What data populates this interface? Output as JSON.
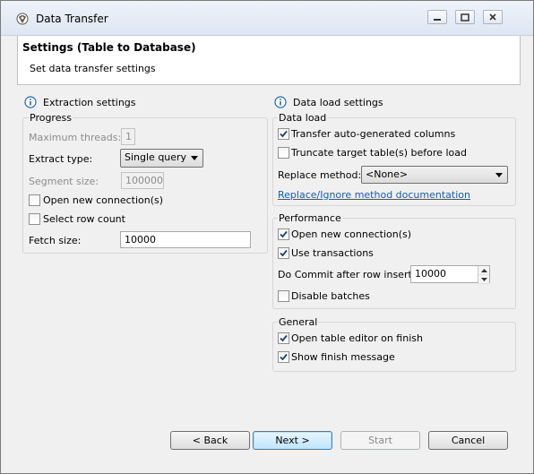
{
  "window": {
    "title": "Data Transfer"
  },
  "header": {
    "title": "Settings (Table to Database)",
    "subtitle": "Set data transfer settings"
  },
  "extraction": {
    "heading": "Extraction settings",
    "progress_group": "Progress",
    "max_threads_label": "Maximum threads:",
    "max_threads_value": "1",
    "extract_type_label": "Extract type:",
    "extract_type_value": "Single query",
    "segment_size_label": "Segment size:",
    "segment_size_value": "100000",
    "open_new_connections": {
      "label": "Open new connection(s)",
      "checked": false
    },
    "select_row_count": {
      "label": "Select row count",
      "checked": false
    },
    "fetch_size_label": "Fetch size:",
    "fetch_size_value": "10000"
  },
  "dataload": {
    "heading": "Data load settings",
    "group": "Data load",
    "transfer_auto_generated": {
      "label": "Transfer auto-generated columns",
      "checked": true
    },
    "truncate_target": {
      "label": "Truncate target table(s) before load",
      "checked": false
    },
    "replace_method_label": "Replace method:",
    "replace_method_value": "<None>",
    "replace_doc_link": "Replace/Ignore method documentation"
  },
  "performance": {
    "group": "Performance",
    "open_new_connections": {
      "label": "Open new connection(s)",
      "checked": true
    },
    "use_transactions": {
      "label": "Use transactions",
      "checked": true
    },
    "commit_label": "Do Commit after row insert:",
    "commit_value": "10000",
    "disable_batches": {
      "label": "Disable batches",
      "checked": false
    }
  },
  "general": {
    "group": "General",
    "open_table_editor": {
      "label": "Open table editor on finish",
      "checked": true
    },
    "show_finish_message": {
      "label": "Show finish message",
      "checked": true
    }
  },
  "buttons": {
    "back": "< Back",
    "next": "Next >",
    "start": "Start",
    "cancel": "Cancel"
  },
  "colors": {
    "link": "#0a5fc2",
    "info_icon": "#1a66b8"
  }
}
